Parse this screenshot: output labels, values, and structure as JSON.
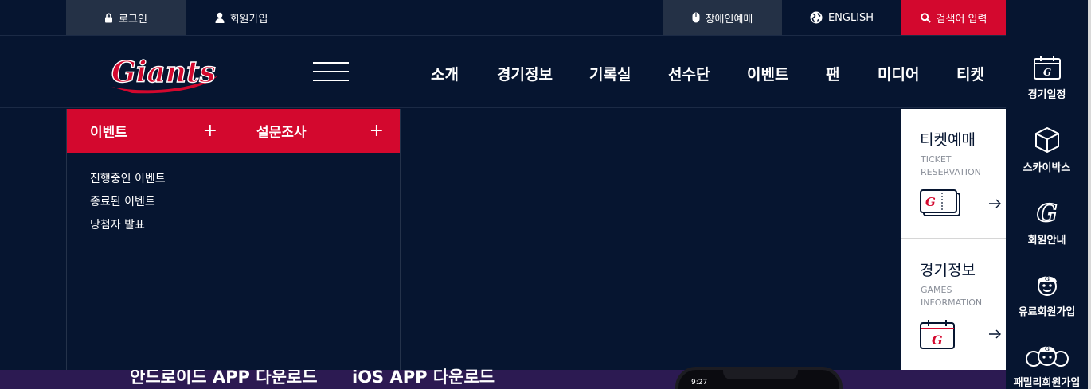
{
  "utility": {
    "login": "로그인",
    "join": "회원가입",
    "accessible_booking": "장애인예매",
    "english": "ENGLISH",
    "search": "검색어 입력"
  },
  "brand": {
    "logo_text": "Giants",
    "accent": "#d3082e",
    "navy": "#061530"
  },
  "nav": [
    "소개",
    "경기정보",
    "기록실",
    "선수단",
    "이벤트",
    "팬",
    "미디어",
    "티켓"
  ],
  "megamenu": [
    {
      "title": "이벤트",
      "items": [
        "진행중인 이벤트",
        "종료된 이벤트",
        "당첨자 발표"
      ]
    },
    {
      "title": "설문조사",
      "items": []
    }
  ],
  "quick": [
    {
      "title": "티켓예매",
      "sub1": "TICKET",
      "sub2": "RESERVATION",
      "icon": "ticket-icon"
    },
    {
      "title": "경기정보",
      "sub1": "GAMES",
      "sub2": "INFORMATION",
      "icon": "calendar-icon"
    }
  ],
  "rail": [
    {
      "label": "경기일정",
      "icon": "calendar-icon"
    },
    {
      "label": "스카이박스",
      "icon": "box-icon"
    },
    {
      "label": "회원안내",
      "icon": "g-logo-icon"
    },
    {
      "label": "유료회원가입",
      "icon": "mascot-icon"
    },
    {
      "label": "패밀리회원가입",
      "icon": "family-icon"
    }
  ],
  "bottom": {
    "android": "안드로이드 APP 다운로드",
    "ios": "iOS APP 다운로드",
    "phone_time": "9:27"
  }
}
